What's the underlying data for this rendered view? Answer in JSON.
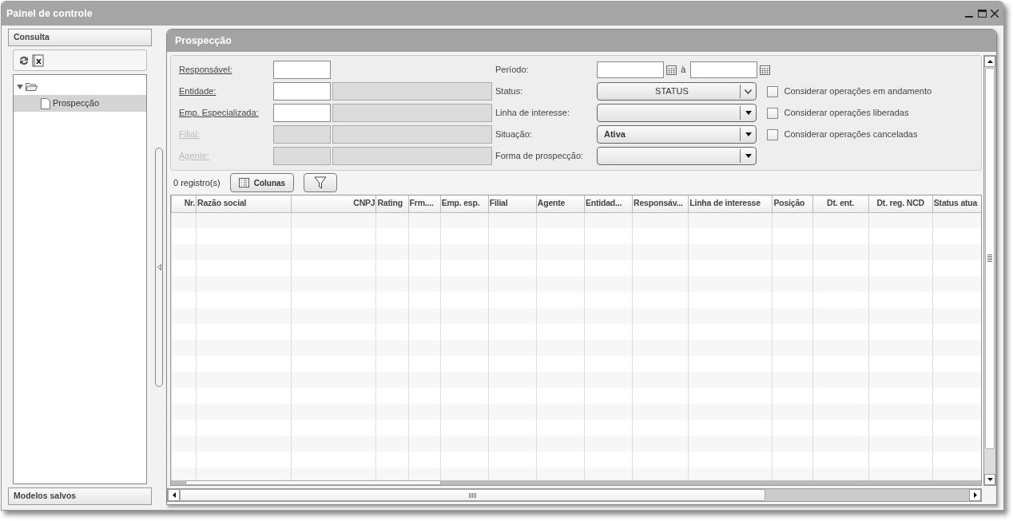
{
  "window": {
    "title": "Painel de controle"
  },
  "sidebar": {
    "title": "Consulta",
    "tree": [
      {
        "expanded": true,
        "children": [
          {
            "label": "Prospecção",
            "selected": true
          }
        ]
      }
    ],
    "footer": "Modelos salvos"
  },
  "panel": {
    "title": "Prospecção",
    "left_fields": [
      {
        "label": "Responsável:",
        "kind": "code",
        "disabled": false
      },
      {
        "label": "Entidade:",
        "kind": "code_description",
        "disabled": false
      },
      {
        "label": "Emp. Especializada:",
        "kind": "code_description",
        "disabled": false
      },
      {
        "label": "Filial:",
        "kind": "code_description",
        "disabled": true
      },
      {
        "label": "Agente:",
        "kind": "code_description",
        "disabled": true
      }
    ],
    "right_fields": [
      {
        "label": "Período:",
        "kind": "date_range",
        "separator": "à"
      },
      {
        "label": "Status:",
        "kind": "button_dropdown",
        "value": "STATUS"
      },
      {
        "label": "Linha de interesse:",
        "kind": "dropdown"
      },
      {
        "label": "Situação:",
        "kind": "dropdown",
        "value": "Ativa"
      },
      {
        "label": "Forma de prospecção:",
        "kind": "dropdown"
      }
    ],
    "checkboxes": [
      {
        "label": "Considerar operações em andamento",
        "checked": false
      },
      {
        "label": "Considerar operações liberadas",
        "checked": false
      },
      {
        "label": "Considerar operações canceladas",
        "checked": false
      }
    ],
    "record_count": "0 registro(s)",
    "columns_button": "Colunas",
    "table": {
      "columns": [
        {
          "label": "Nr."
        },
        {
          "label": "Razão social"
        },
        {
          "label": "CNPJ"
        },
        {
          "label": "Rating"
        },
        {
          "label": "Frm...."
        },
        {
          "label": "Emp. esp."
        },
        {
          "label": "Filial"
        },
        {
          "label": "Agente"
        },
        {
          "label": "Entidad..."
        },
        {
          "label": "Responsáv..."
        },
        {
          "label": "Linha de interesse"
        },
        {
          "label": "Posição"
        },
        {
          "label": "Dt. ent."
        },
        {
          "label": "Dt. reg. NCD"
        },
        {
          "label": "Status atua"
        }
      ]
    }
  }
}
